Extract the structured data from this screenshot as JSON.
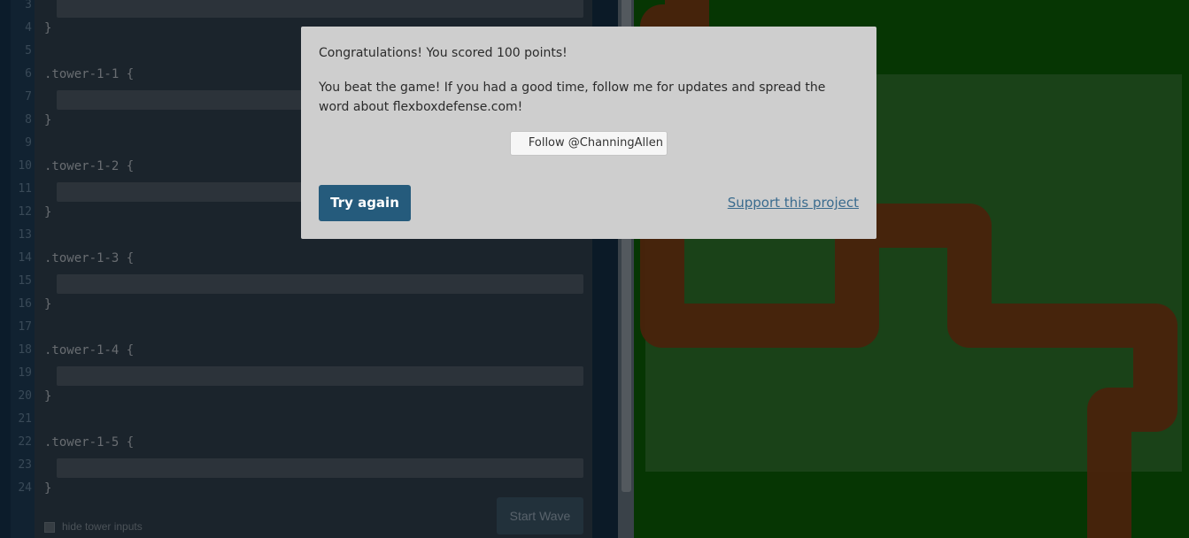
{
  "editor": {
    "line_numbers": [
      "3",
      "4",
      "5",
      "6",
      "7",
      "8",
      "9",
      "10",
      "11",
      "12",
      "13",
      "14",
      "15",
      "16",
      "17",
      "18",
      "19",
      "20",
      "21",
      "22",
      "23",
      "24"
    ],
    "code_lines": [
      {
        "line": "4",
        "text": "}"
      },
      {
        "line": "6",
        "text": ".tower-1-1 {"
      },
      {
        "line": "8",
        "text": "}"
      },
      {
        "line": "10",
        "text": ".tower-1-2 {"
      },
      {
        "line": "12",
        "text": "}"
      },
      {
        "line": "14",
        "text": ".tower-1-3 {"
      },
      {
        "line": "16",
        "text": "}"
      },
      {
        "line": "18",
        "text": ".tower-1-4 {"
      },
      {
        "line": "20",
        "text": "}"
      },
      {
        "line": "22",
        "text": ".tower-1-5 {"
      },
      {
        "line": "24",
        "text": "}"
      }
    ],
    "tower_inputs": [
      {
        "name": "tower-1-0-input",
        "value": ""
      },
      {
        "name": "tower-1-1-input",
        "value": ""
      },
      {
        "name": "tower-1-2-input",
        "value": ""
      },
      {
        "name": "tower-1-3-input",
        "value": ""
      },
      {
        "name": "tower-1-4-input",
        "value": ""
      },
      {
        "name": "tower-1-5-input",
        "value": ""
      }
    ],
    "start_wave_label": "Start Wave",
    "hide_inputs_label": "hide tower inputs",
    "hide_inputs_checked": false
  },
  "modal": {
    "score_message": "Congratulations! You scored 100 points!",
    "beat_message": "You beat the game! If you had a good time, follow me for updates and spread the word about flexboxdefense.com!",
    "follow_label": "Follow @ChanningAllen",
    "try_again_label": "Try again",
    "support_label": "Support this project"
  },
  "colors": {
    "board_grass": "#0a5a06",
    "field": "#2c6e29",
    "path": "#7a3a14",
    "try_again_bg": "#255b7c",
    "support_link": "#3a6b8e"
  },
  "icons": {
    "twitter": "twitter-icon"
  }
}
